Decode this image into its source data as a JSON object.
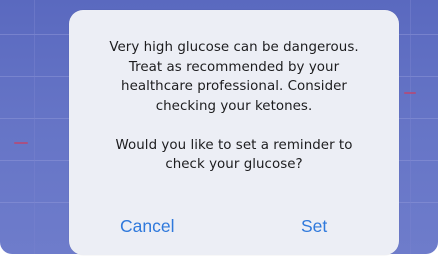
{
  "alert": {
    "message_line_1": "Very high glucose can be dangerous.",
    "message_line_2": "Treat as recommended by your",
    "message_line_3": "healthcare professional. Consider",
    "message_line_4": "checking your ketones.",
    "question_line_1": "Would you like to set a reminder to",
    "question_line_2": "check your glucose?",
    "cancel_label": "Cancel",
    "set_label": "Set"
  },
  "colors": {
    "backdrop": "#6574c6",
    "alert_background": "#eceef5",
    "action_tint": "#2f79dc",
    "message_text": "#1c1c1e"
  }
}
